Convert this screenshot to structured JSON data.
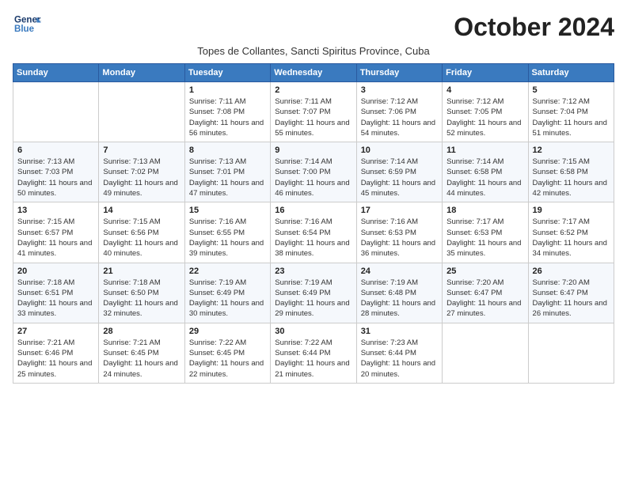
{
  "header": {
    "logo_line1": "General",
    "logo_line2": "Blue",
    "month": "October 2024",
    "subtitle": "Topes de Collantes, Sancti Spiritus Province, Cuba"
  },
  "weekdays": [
    "Sunday",
    "Monday",
    "Tuesday",
    "Wednesday",
    "Thursday",
    "Friday",
    "Saturday"
  ],
  "weeks": [
    [
      {
        "day": "",
        "info": ""
      },
      {
        "day": "",
        "info": ""
      },
      {
        "day": "1",
        "info": "Sunrise: 7:11 AM\nSunset: 7:08 PM\nDaylight: 11 hours and 56 minutes."
      },
      {
        "day": "2",
        "info": "Sunrise: 7:11 AM\nSunset: 7:07 PM\nDaylight: 11 hours and 55 minutes."
      },
      {
        "day": "3",
        "info": "Sunrise: 7:12 AM\nSunset: 7:06 PM\nDaylight: 11 hours and 54 minutes."
      },
      {
        "day": "4",
        "info": "Sunrise: 7:12 AM\nSunset: 7:05 PM\nDaylight: 11 hours and 52 minutes."
      },
      {
        "day": "5",
        "info": "Sunrise: 7:12 AM\nSunset: 7:04 PM\nDaylight: 11 hours and 51 minutes."
      }
    ],
    [
      {
        "day": "6",
        "info": "Sunrise: 7:13 AM\nSunset: 7:03 PM\nDaylight: 11 hours and 50 minutes."
      },
      {
        "day": "7",
        "info": "Sunrise: 7:13 AM\nSunset: 7:02 PM\nDaylight: 11 hours and 49 minutes."
      },
      {
        "day": "8",
        "info": "Sunrise: 7:13 AM\nSunset: 7:01 PM\nDaylight: 11 hours and 47 minutes."
      },
      {
        "day": "9",
        "info": "Sunrise: 7:14 AM\nSunset: 7:00 PM\nDaylight: 11 hours and 46 minutes."
      },
      {
        "day": "10",
        "info": "Sunrise: 7:14 AM\nSunset: 6:59 PM\nDaylight: 11 hours and 45 minutes."
      },
      {
        "day": "11",
        "info": "Sunrise: 7:14 AM\nSunset: 6:58 PM\nDaylight: 11 hours and 44 minutes."
      },
      {
        "day": "12",
        "info": "Sunrise: 7:15 AM\nSunset: 6:58 PM\nDaylight: 11 hours and 42 minutes."
      }
    ],
    [
      {
        "day": "13",
        "info": "Sunrise: 7:15 AM\nSunset: 6:57 PM\nDaylight: 11 hours and 41 minutes."
      },
      {
        "day": "14",
        "info": "Sunrise: 7:15 AM\nSunset: 6:56 PM\nDaylight: 11 hours and 40 minutes."
      },
      {
        "day": "15",
        "info": "Sunrise: 7:16 AM\nSunset: 6:55 PM\nDaylight: 11 hours and 39 minutes."
      },
      {
        "day": "16",
        "info": "Sunrise: 7:16 AM\nSunset: 6:54 PM\nDaylight: 11 hours and 38 minutes."
      },
      {
        "day": "17",
        "info": "Sunrise: 7:16 AM\nSunset: 6:53 PM\nDaylight: 11 hours and 36 minutes."
      },
      {
        "day": "18",
        "info": "Sunrise: 7:17 AM\nSunset: 6:53 PM\nDaylight: 11 hours and 35 minutes."
      },
      {
        "day": "19",
        "info": "Sunrise: 7:17 AM\nSunset: 6:52 PM\nDaylight: 11 hours and 34 minutes."
      }
    ],
    [
      {
        "day": "20",
        "info": "Sunrise: 7:18 AM\nSunset: 6:51 PM\nDaylight: 11 hours and 33 minutes."
      },
      {
        "day": "21",
        "info": "Sunrise: 7:18 AM\nSunset: 6:50 PM\nDaylight: 11 hours and 32 minutes."
      },
      {
        "day": "22",
        "info": "Sunrise: 7:19 AM\nSunset: 6:49 PM\nDaylight: 11 hours and 30 minutes."
      },
      {
        "day": "23",
        "info": "Sunrise: 7:19 AM\nSunset: 6:49 PM\nDaylight: 11 hours and 29 minutes."
      },
      {
        "day": "24",
        "info": "Sunrise: 7:19 AM\nSunset: 6:48 PM\nDaylight: 11 hours and 28 minutes."
      },
      {
        "day": "25",
        "info": "Sunrise: 7:20 AM\nSunset: 6:47 PM\nDaylight: 11 hours and 27 minutes."
      },
      {
        "day": "26",
        "info": "Sunrise: 7:20 AM\nSunset: 6:47 PM\nDaylight: 11 hours and 26 minutes."
      }
    ],
    [
      {
        "day": "27",
        "info": "Sunrise: 7:21 AM\nSunset: 6:46 PM\nDaylight: 11 hours and 25 minutes."
      },
      {
        "day": "28",
        "info": "Sunrise: 7:21 AM\nSunset: 6:45 PM\nDaylight: 11 hours and 24 minutes."
      },
      {
        "day": "29",
        "info": "Sunrise: 7:22 AM\nSunset: 6:45 PM\nDaylight: 11 hours and 22 minutes."
      },
      {
        "day": "30",
        "info": "Sunrise: 7:22 AM\nSunset: 6:44 PM\nDaylight: 11 hours and 21 minutes."
      },
      {
        "day": "31",
        "info": "Sunrise: 7:23 AM\nSunset: 6:44 PM\nDaylight: 11 hours and 20 minutes."
      },
      {
        "day": "",
        "info": ""
      },
      {
        "day": "",
        "info": ""
      }
    ]
  ]
}
